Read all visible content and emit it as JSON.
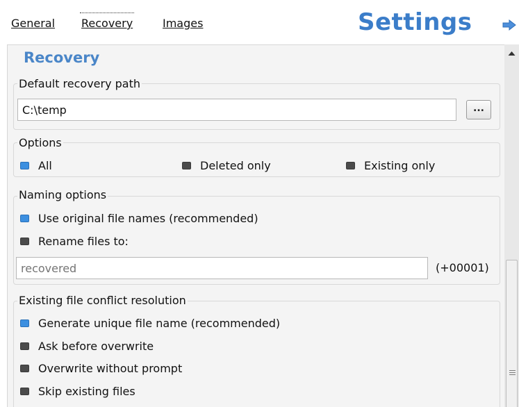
{
  "tabs": {
    "general": "General",
    "recovery": "Recovery",
    "images": "Images"
  },
  "header": {
    "title": "Settings"
  },
  "section": {
    "heading": "Recovery"
  },
  "default_path": {
    "legend": "Default recovery path",
    "value": "C:\\temp",
    "browse_label": "..."
  },
  "options": {
    "legend": "Options",
    "items": [
      {
        "label": "All",
        "selected": true
      },
      {
        "label": "Deleted only",
        "selected": false
      },
      {
        "label": "Existing only",
        "selected": false
      }
    ]
  },
  "naming": {
    "legend": "Naming options",
    "items": [
      {
        "label": "Use original file names (recommended)",
        "selected": true
      },
      {
        "label": "Rename files to:",
        "selected": false
      }
    ],
    "rename_placeholder": "recovered",
    "counter": "(+00001)"
  },
  "conflict": {
    "legend": "Existing file conflict resolution",
    "items": [
      {
        "label": "Generate unique file name (recommended)",
        "selected": true
      },
      {
        "label": "Ask before overwrite",
        "selected": false
      },
      {
        "label": "Overwrite without prompt",
        "selected": false
      },
      {
        "label": "Skip existing files",
        "selected": false
      }
    ]
  },
  "colors": {
    "accent": "#3b7dc9",
    "radio_selected": "#3c8fe0",
    "radio_unselected": "#4b4b4b",
    "panel_bg": "#f4f4f4"
  },
  "icons": {
    "forward": "arrow-right-icon",
    "scroll_up": "chevron-up-icon",
    "scroll_grip": "grip-icon"
  }
}
